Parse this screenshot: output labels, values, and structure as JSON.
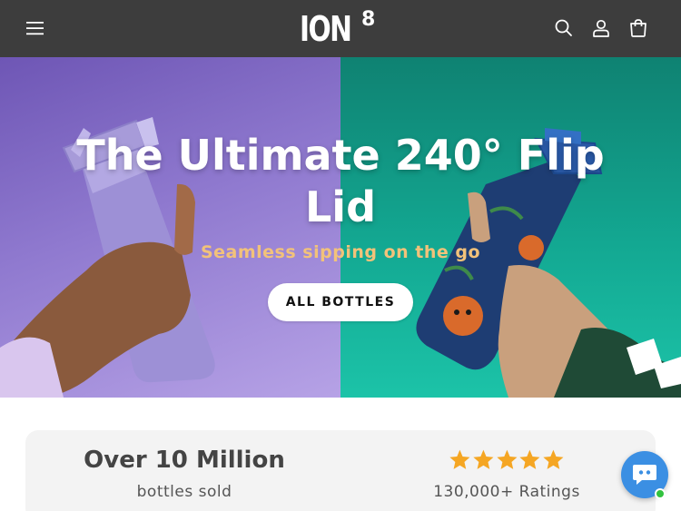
{
  "header": {
    "menu_icon": "hamburger-menu-icon",
    "logo_main": "ION",
    "logo_sup": "8",
    "search_icon": "search-icon",
    "account_icon": "user-icon",
    "cart_icon": "cart-icon",
    "background": "#3d3d3d"
  },
  "hero": {
    "title": "The Ultimate 240° Flip Lid",
    "subtitle": "Seamless sipping on the go",
    "button_label": "ALL BOTTLES",
    "left_color": "#8f79cf",
    "right_color": "#13a892",
    "subtitle_color": "#f2c27a"
  },
  "stats": {
    "sold_headline": "Over 10 Million",
    "sold_caption": "bottles sold",
    "rating_stars": 5,
    "ratings_caption": "130,000+ Ratings",
    "star_color": "#f5a623"
  },
  "chat": {
    "icon": "chat-bubble-icon",
    "status": "online",
    "color": "#3b8fe3"
  }
}
